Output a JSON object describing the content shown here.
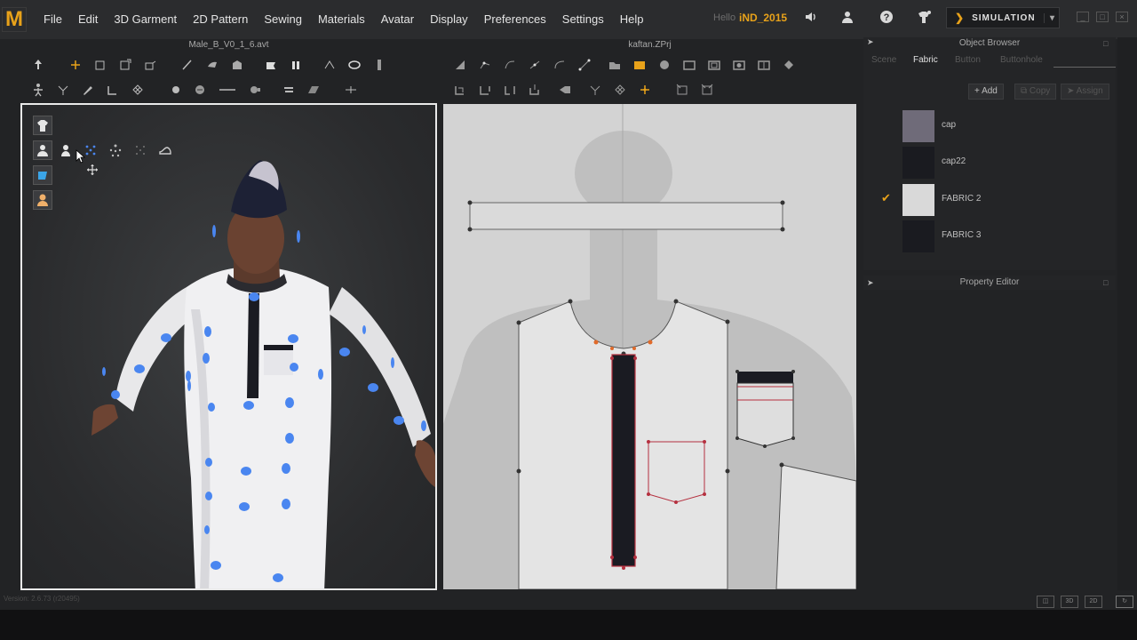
{
  "app": {
    "logo": "M"
  },
  "menu": [
    "File",
    "Edit",
    "3D Garment",
    "2D Pattern",
    "Sewing",
    "Materials",
    "Avatar",
    "Display",
    "Preferences",
    "Settings",
    "Help"
  ],
  "user": {
    "hello": "Hello",
    "name": "iND_2015"
  },
  "simulation": {
    "label": "SIMULATION"
  },
  "panels": {
    "view3d_title": "Male_B_V0_1_6.avt",
    "view2d_title": "kaftan.ZPrj"
  },
  "object_browser": {
    "title": "Object Browser",
    "tabs": [
      "Scene",
      "Fabric",
      "Button",
      "Buttonhole"
    ],
    "active_tab": "Fabric",
    "actions": {
      "add": "Add",
      "copy": "Copy",
      "assign": "Assign"
    },
    "fabrics": [
      {
        "name": "cap",
        "swatch": "#6f6b79",
        "checked": false
      },
      {
        "name": "cap22",
        "swatch": "#1a1b20",
        "checked": false
      },
      {
        "name": "FABRIC 2",
        "swatch": "#d9d9d9",
        "checked": true
      },
      {
        "name": "FABRIC 3",
        "swatch": "#1a1b20",
        "checked": false
      }
    ]
  },
  "property_editor": {
    "title": "Property Editor"
  },
  "status": {
    "version": "Version: 2.6.73    (r20495)"
  },
  "colors": {
    "accent": "#e8a21a",
    "pin": "#4a86f0"
  }
}
